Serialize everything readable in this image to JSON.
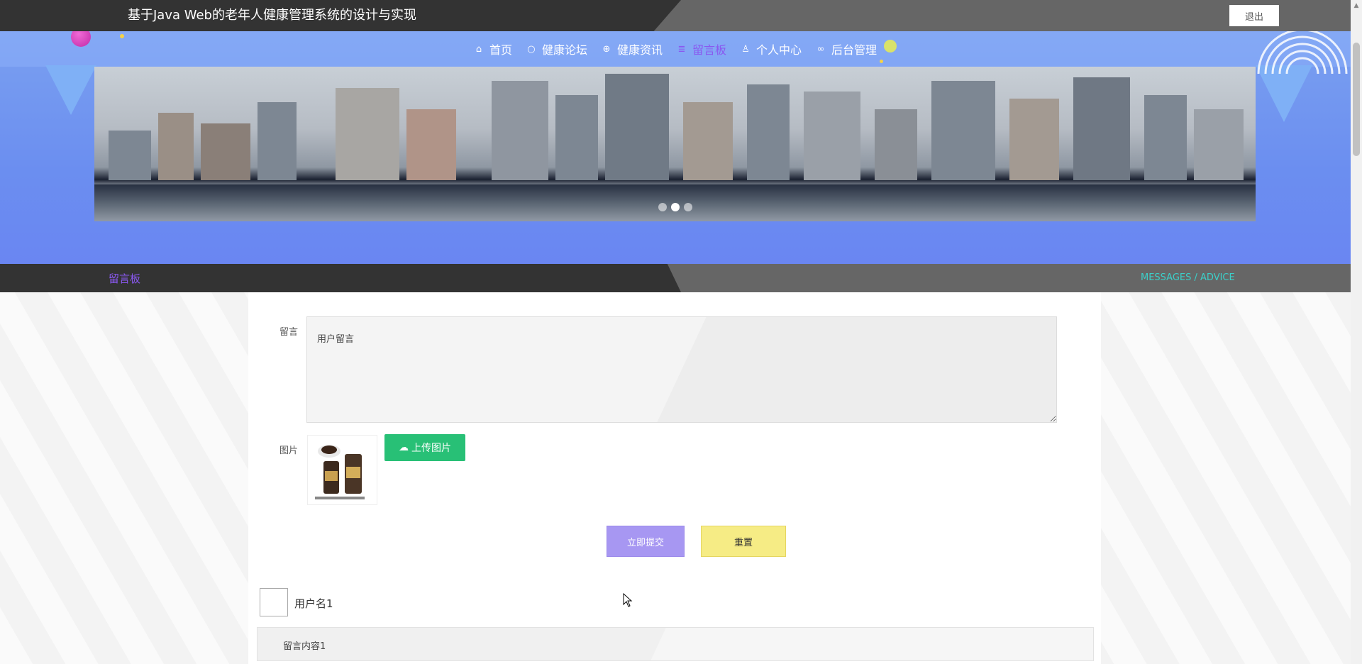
{
  "header": {
    "site_title": "基于Java Web的老年人健康管理系统的设计与实现",
    "logout_label": "退出"
  },
  "nav": {
    "items": [
      {
        "label": "首页",
        "icon": "home-icon"
      },
      {
        "label": "健康论坛",
        "icon": "circle-icon"
      },
      {
        "label": "健康资讯",
        "icon": "globe-icon"
      },
      {
        "label": "留言板",
        "icon": "database-icon",
        "active": true
      },
      {
        "label": "个人中心",
        "icon": "user-icon"
      },
      {
        "label": "后台管理",
        "icon": "link-icon"
      }
    ]
  },
  "banner": {
    "slide_count": 3,
    "active_slide": 2
  },
  "section": {
    "title": "留言板",
    "subtitle": "MESSAGES / ADVICE"
  },
  "form": {
    "message_label": "留言",
    "message_value": "用户留言",
    "image_label": "图片",
    "upload_label": "上传图片",
    "submit_label": "立即提交",
    "reset_label": "重置"
  },
  "messages": [
    {
      "username": "用户名1",
      "content": "留言内容1"
    }
  ],
  "colors": {
    "accent": "#8a58f0",
    "upload": "#28c076",
    "submit": "#a797f2",
    "reset": "#f6ec85",
    "subtitle": "#3ccfc9"
  }
}
